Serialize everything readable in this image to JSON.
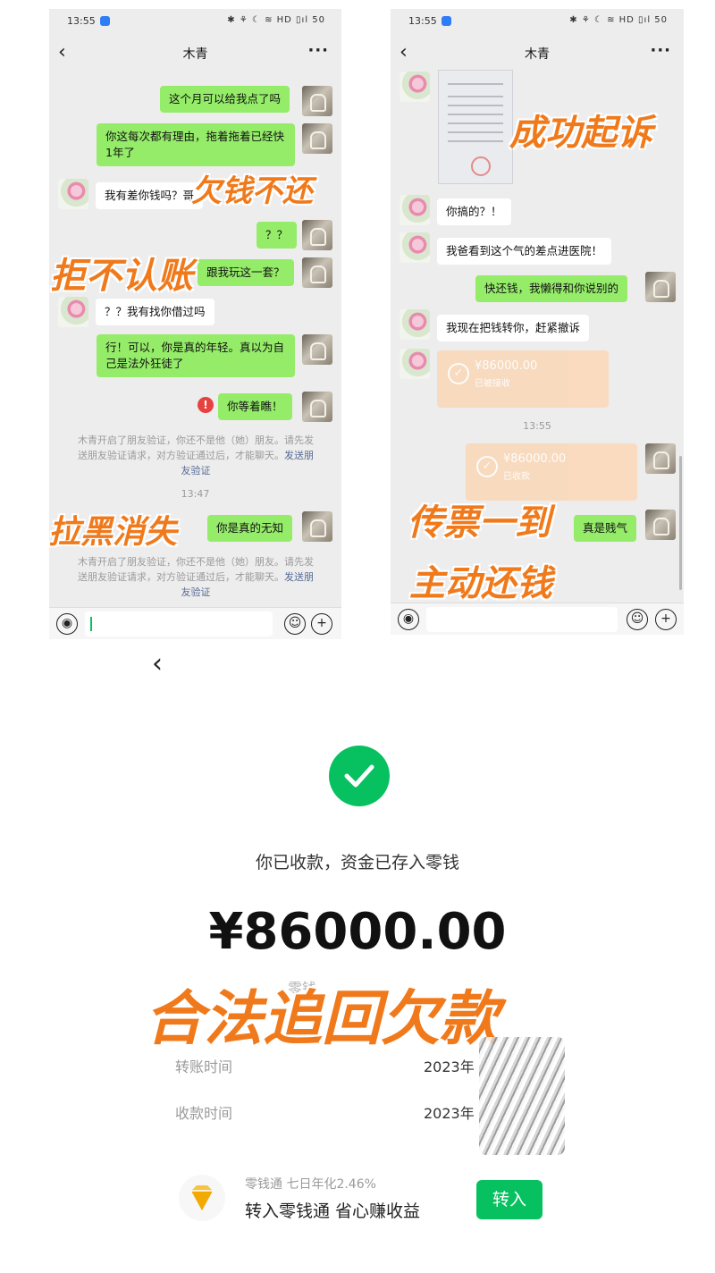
{
  "left_phone": {
    "status_time": "13:55",
    "status_icons": "✱ ⚘ ☾ ≋ HD ▯ıl 50",
    "title": "木青",
    "messages": [
      "这个月可以给我点了吗",
      "你这每次都有理由，拖着拖着已经快1年了",
      "我有差你钱吗？哥",
      "？？",
      "跟我玩这一套？",
      "？？我有找你借过吗",
      "行！可以，你是真的年轻。真以为自己是法外狂徒了",
      "你等着瞧！",
      "你是真的无知"
    ],
    "system_note_1": "木青开启了朋友验证，你还不是他（她）朋友。请先发送朋友验证请求，对方验证通过后，才能聊天。",
    "system_note_1_link": "发送朋友验证",
    "time_divider": "13:47",
    "system_note_2": "木青开启了朋友验证，你还不是他（她）朋友。请先发送朋友验证请求，对方验证通过后，才能聊天。",
    "system_note_2_link": "发送朋友验证",
    "error_mark": "!"
  },
  "right_phone": {
    "status_time": "13:55",
    "status_icons": "✱ ⚘ ☾ ≋ HD ▯ıl 50",
    "title": "木青",
    "messages": [
      "你搞的？！",
      "我爸看到这个气的差点进医院！",
      "快还钱，我懒得和你说别的",
      "我现在把钱转你，赶紧撤诉",
      "真是贱气"
    ],
    "transfer_in": {
      "amount": "¥86000.00",
      "status": "已被接收"
    },
    "time_divider": "13:55",
    "transfer_out": {
      "amount": "¥86000.00",
      "status": "已收款"
    }
  },
  "overlays": {
    "left_1": "欠钱不还",
    "left_2": "拒不认账",
    "left_3": "拉黑消失",
    "right_1": "成功起诉",
    "right_2": "传票一到",
    "right_3": "主动还钱",
    "bottom": "合法追回欠款"
  },
  "receipt": {
    "title": "你已收款，资金已存入零钱",
    "amount": "¥86000.00",
    "sub": "零钱",
    "rows": [
      {
        "label": "转账时间",
        "value": "2023年"
      },
      {
        "label": "收款时间",
        "value": "2023年"
      }
    ],
    "lingqiantong_line1": "零钱通 七日年化2.46%",
    "lingqiantong_line2": "转入零钱通 省心赚收益",
    "transfer_button": "转入"
  },
  "icons": {
    "back": "chevron-left-icon",
    "more": "more-icon",
    "voice": "voice-icon",
    "emoji": "emoji-icon",
    "plus": "plus-icon",
    "check": "check-icon",
    "diamond": "diamond-icon"
  },
  "colors": {
    "wechat_green": "#07c160",
    "bubble_green": "#95ec69",
    "overlay_orange": "#f07a1b",
    "transfer_orange": "#fbd7b6",
    "error_red": "#e64340"
  }
}
